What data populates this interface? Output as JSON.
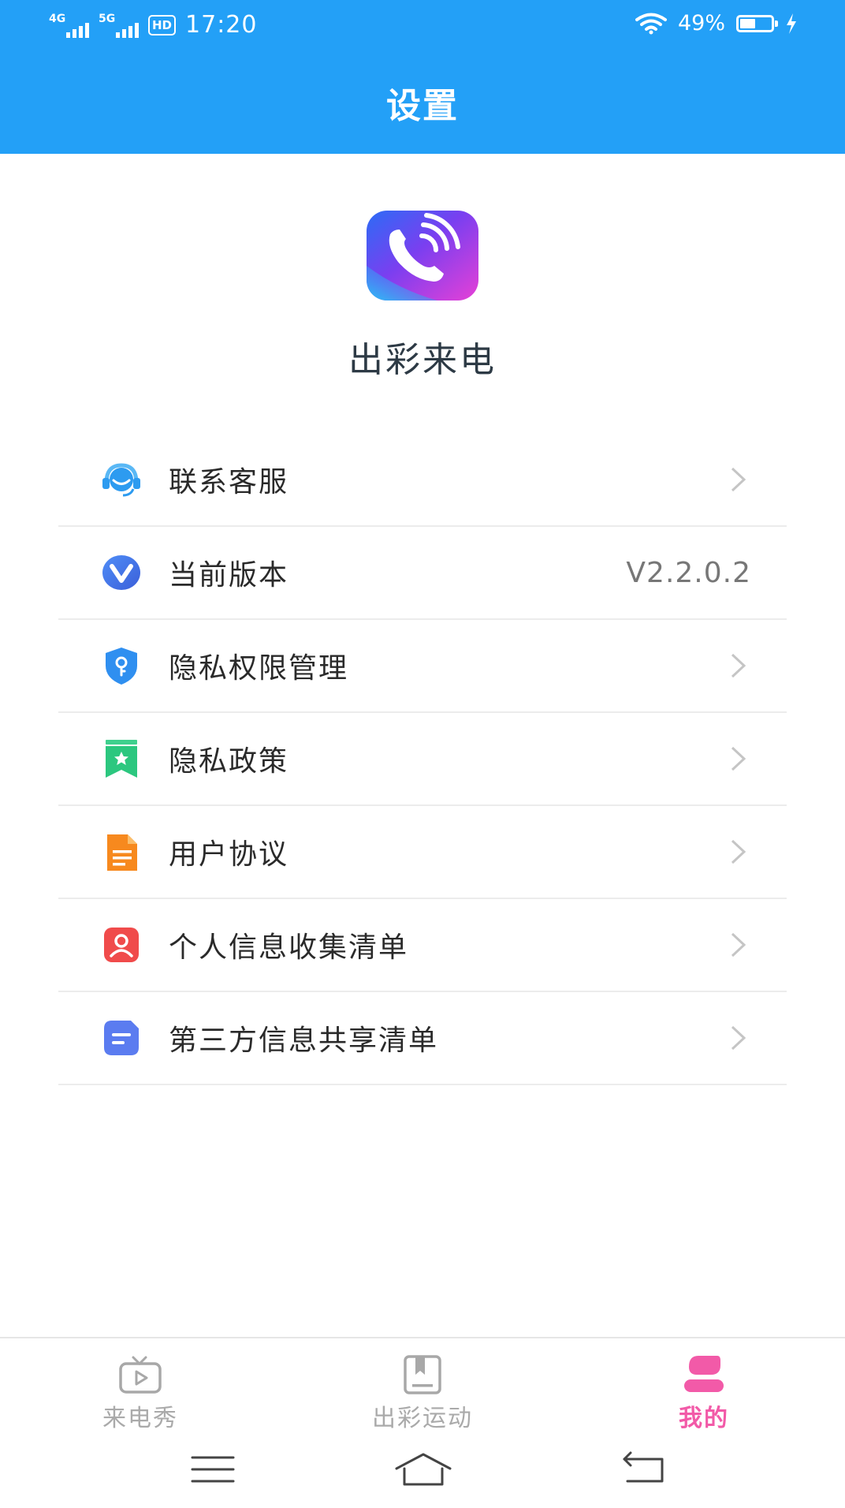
{
  "status_bar": {
    "network_1": "4G",
    "network_2": "5G",
    "hd_badge": "HD",
    "time": "17:20",
    "battery_percent": "49%",
    "battery_level": 0.49
  },
  "header": {
    "title": "设置"
  },
  "app": {
    "name": "出彩来电"
  },
  "menu": {
    "items": [
      {
        "label": "联系客服",
        "icon": "headset-icon"
      },
      {
        "label": "当前版本",
        "icon": "version-icon",
        "value": "V2.2.0.2"
      },
      {
        "label": "隐私权限管理",
        "icon": "shield-key-icon"
      },
      {
        "label": "隐私政策",
        "icon": "bookmark-star-icon"
      },
      {
        "label": "用户协议",
        "icon": "document-icon"
      },
      {
        "label": "个人信息收集清单",
        "icon": "user-card-icon"
      },
      {
        "label": "第三方信息共享清单",
        "icon": "list-card-icon"
      }
    ]
  },
  "bottom_nav": {
    "tabs": [
      {
        "label": "来电秀",
        "icon": "tv-play-icon",
        "active": false
      },
      {
        "label": "出彩运动",
        "icon": "book-icon",
        "active": false
      },
      {
        "label": "我的",
        "icon": "profile-icon",
        "active": true
      }
    ]
  },
  "colors": {
    "primary": "#23a0f7",
    "active_tab": "#f25aa8",
    "inactive_tab": "#aaaaaa"
  }
}
